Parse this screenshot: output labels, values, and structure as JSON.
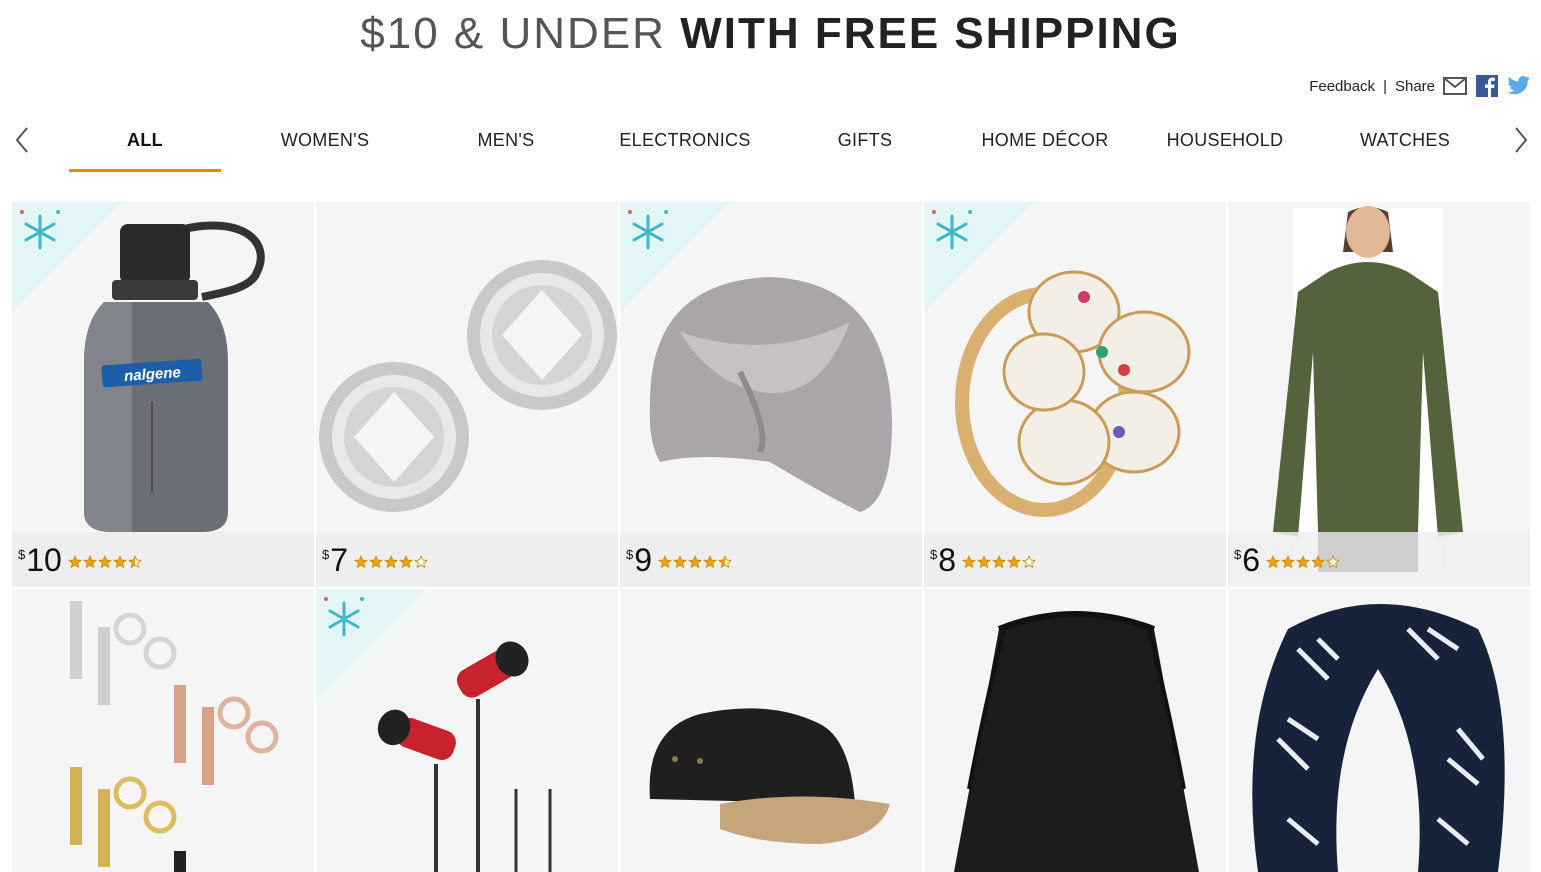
{
  "banner": {
    "light": "$10 & UNDER",
    "bold": "WITH FREE SHIPPING"
  },
  "share": {
    "feedback": "Feedback",
    "separator": "|",
    "share": "Share"
  },
  "nav": {
    "tabs": [
      {
        "label": "ALL",
        "active": true
      },
      {
        "label": "WOMEN'S"
      },
      {
        "label": "MEN'S"
      },
      {
        "label": "ELECTRONICS"
      },
      {
        "label": "GIFTS"
      },
      {
        "label": "HOME DÉCOR"
      },
      {
        "label": "HOUSEHOLD"
      },
      {
        "label": "WATCHES"
      }
    ]
  },
  "colors": {
    "accent": "#f08804",
    "star": "#f0a20a",
    "snow": "#3fb8c8"
  },
  "products": [
    {
      "name": "water-bottle",
      "currency": "$",
      "price": "10",
      "rating": 4.5,
      "snowflake": true
    },
    {
      "name": "earrings",
      "currency": "$",
      "price": "7",
      "rating": 4,
      "snowflake": false
    },
    {
      "name": "turban",
      "currency": "$",
      "price": "9",
      "rating": 4.5,
      "snowflake": true
    },
    {
      "name": "ring",
      "currency": "$",
      "price": "8",
      "rating": 4,
      "snowflake": true
    },
    {
      "name": "shirt",
      "currency": "$",
      "price": "6",
      "rating": 4,
      "snowflake": false
    },
    {
      "name": "stud-earrings",
      "currency": "$",
      "price": "",
      "rating": null,
      "snowflake": false
    },
    {
      "name": "earbuds",
      "currency": "$",
      "price": "",
      "rating": null,
      "snowflake": true
    },
    {
      "name": "cap",
      "currency": "$",
      "price": "",
      "rating": null,
      "snowflake": false
    },
    {
      "name": "drawstring-bag",
      "currency": "$",
      "price": "",
      "rating": null,
      "snowflake": false
    },
    {
      "name": "scarf",
      "currency": "$",
      "price": "",
      "rating": null,
      "snowflake": false
    }
  ]
}
